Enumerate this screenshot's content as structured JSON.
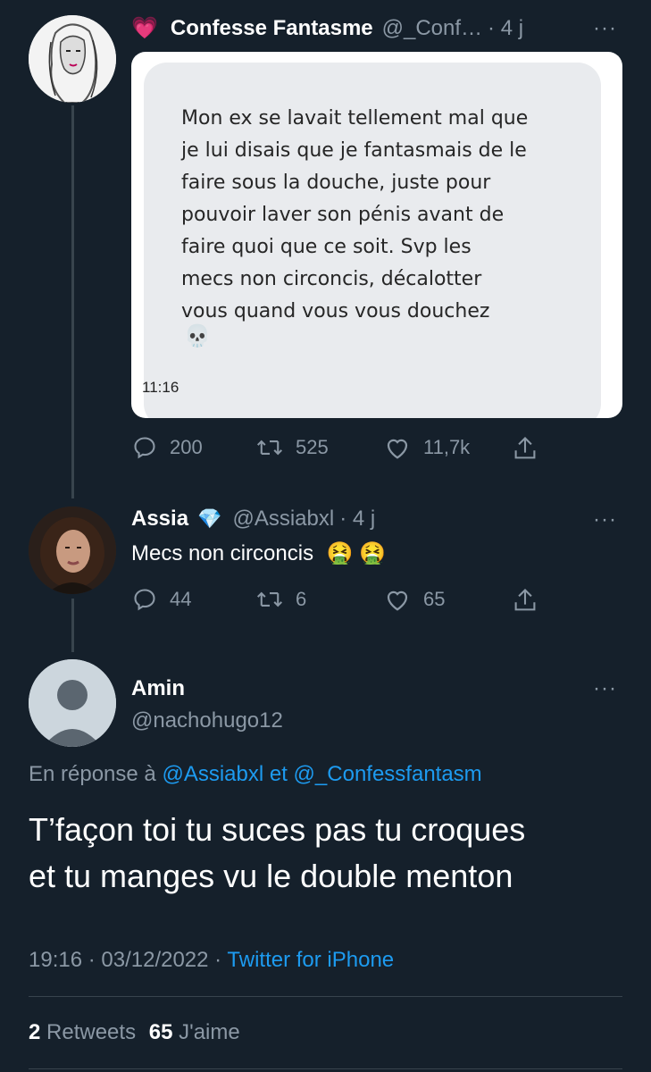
{
  "tweet1": {
    "emoji": "💗",
    "name": "Confesse Fantasme",
    "handle": "@_Conf…",
    "time": "· 4 j",
    "image": {
      "message_lines": [
        "Mon ex se lavait tellement mal que",
        "je lui disais que je fantasmais de le",
        "faire sous la douche, juste pour",
        "pouvoir laver son pénis avant de",
        "faire quoi que ce soit. Svp les",
        "mecs non circoncis, décalotter",
        "vous quand vous vous douchez"
      ],
      "skull": "💀",
      "time": "11:16"
    },
    "stats": {
      "replies": "200",
      "retweets": "525",
      "likes": "11,7k"
    }
  },
  "tweet2": {
    "name": "Assia",
    "badge": "💎",
    "handle": "@Assiabxl",
    "time": "· 4 j",
    "text": "Mecs non circoncis",
    "emojis": "🤮 🤮",
    "stats": {
      "replies": "44",
      "retweets": "6",
      "likes": "65"
    }
  },
  "main": {
    "name": "Amin",
    "handle": "@nachohugo12",
    "reply_prefix": "En réponse à",
    "reply_user1": "@Assiabxl",
    "reply_and": "et",
    "reply_user2": "@_Confessfantasm",
    "text_line1": "T’façon toi tu suces pas tu croques",
    "text_line2": "et tu manges vu le double menton",
    "timestamp": "19:16 · 03/12/2022 ·",
    "source": "Twitter for iPhone",
    "retweets_count": "2",
    "retweets_label": "Retweets",
    "likes_count": "65",
    "likes_label": "J'aime"
  },
  "more_icon": "···"
}
